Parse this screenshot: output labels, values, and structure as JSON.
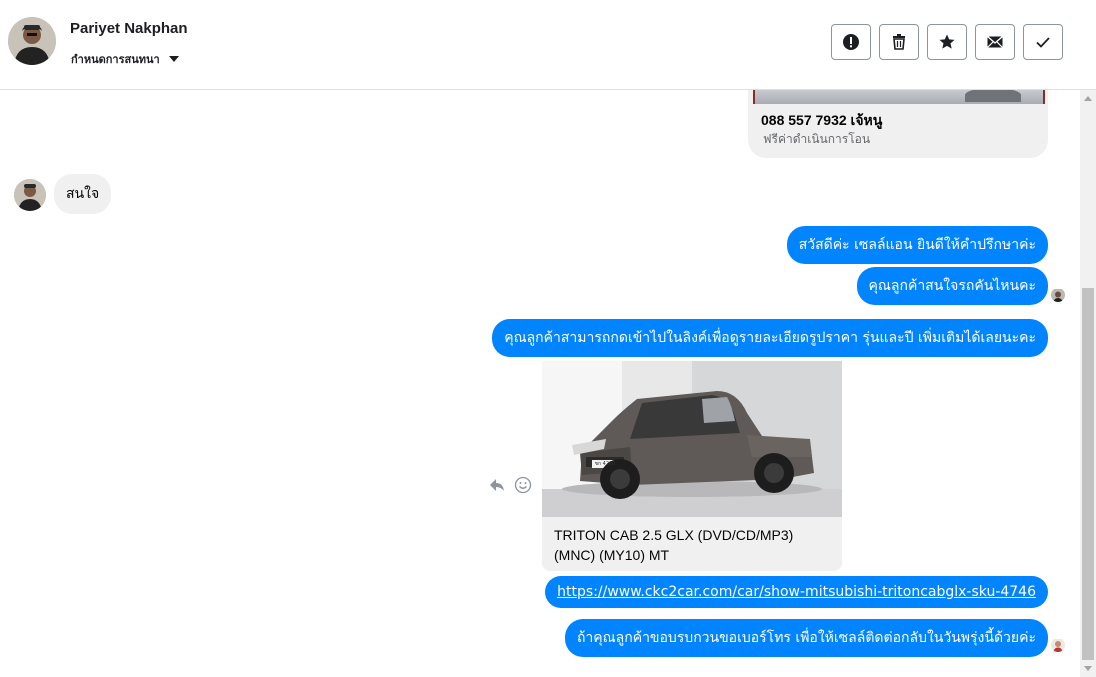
{
  "contact": {
    "name": "Pariyet Nakphan",
    "label_dropdown": "กำหนดการสนทนา"
  },
  "header_actions": [
    {
      "icon": "exclamation-icon",
      "name": "mark-spam-button"
    },
    {
      "icon": "trash-icon",
      "name": "delete-button"
    },
    {
      "icon": "star-icon",
      "name": "star-button"
    },
    {
      "icon": "envelope-icon",
      "name": "mark-unread-button"
    },
    {
      "icon": "checkmark-icon",
      "name": "mark-done-button"
    }
  ],
  "messages": {
    "card_top": {
      "title": "088 557 7932 เจ้หนู",
      "subtitle": "ฟรีค่าดำเนินการโอน"
    },
    "incoming_1": "สนใจ",
    "outgoing_1": "สวัสดีค่ะ เซลล์แอน ยินดีให้คำปรึกษาค่ะ",
    "outgoing_2": "คุณลูกค้าสนใจรถคันไหนคะ",
    "outgoing_3": "คุณลูกค้าสามารถกดเข้าไปในลิงค์เพื่อดูรายละเอียดรูปราคา รุ่นและปี เพิ่มเติมได้เลยนะคะ",
    "car_card": {
      "title": "TRITON CAB 2.5 GLX (DVD/CD/MP3) (MNC) (MY10) MT",
      "plate": "ชก 4260"
    },
    "outgoing_link": "https://www.ckc2car.com/car/show-mitsubishi-tritoncabglx-sku-4746",
    "outgoing_4": "ถ้าคุณลูกค้าขอบรบกวนขอเบอร์โทร เพื่อให้เซลล์ติดต่อกลับในวันพรุ่งนี้ด้วยค่ะ"
  },
  "colors": {
    "outgoing_bubble": "#0084ff",
    "incoming_bubble": "#f0f0f0",
    "header_border": "#dddfe2"
  }
}
